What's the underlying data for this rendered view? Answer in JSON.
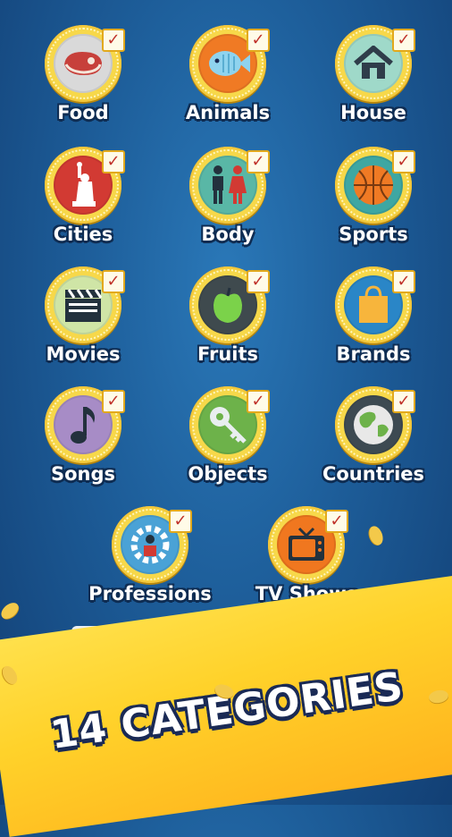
{
  "categories": [
    {
      "label": "Food",
      "icon": "meat-icon",
      "bg": "#d9d9d9"
    },
    {
      "label": "Animals",
      "icon": "fish-icon",
      "bg": "#f07a24"
    },
    {
      "label": "House",
      "icon": "house-icon",
      "bg": "#9fd9c9"
    },
    {
      "label": "Cities",
      "icon": "statue-of-liberty-icon",
      "bg": "#d23a33"
    },
    {
      "label": "Body",
      "icon": "people-icon",
      "bg": "#59b7a6"
    },
    {
      "label": "Sports",
      "icon": "basketball-icon",
      "bg": "#3ea7a2"
    },
    {
      "label": "Movies",
      "icon": "clapperboard-icon",
      "bg": "#cfe5a6"
    },
    {
      "label": "Fruits",
      "icon": "apple-icon",
      "bg": "#3f4a4e"
    },
    {
      "label": "Brands",
      "icon": "shopping-bag-icon",
      "bg": "#2a86c7"
    },
    {
      "label": "Songs",
      "icon": "music-note-icon",
      "bg": "#a78cc6"
    },
    {
      "label": "Objects",
      "icon": "key-icon",
      "bg": "#6db24a"
    },
    {
      "label": "Countries",
      "icon": "globe-icon",
      "bg": "#3d4a52"
    },
    {
      "label": "Professions",
      "icon": "worker-gear-icon",
      "bg": "#4aa2d6"
    },
    {
      "label": "TV Shows",
      "icon": "television-icon",
      "bg": "#f0771f"
    }
  ],
  "check_mark": "✓",
  "banner": {
    "text": "14 CATEGORIES"
  }
}
